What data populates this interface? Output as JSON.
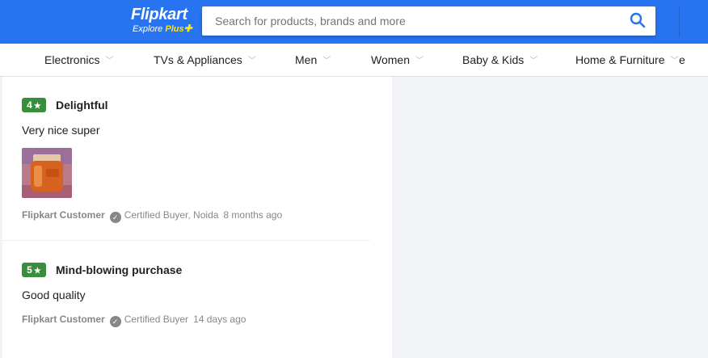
{
  "header": {
    "logo_name": "Flipkart",
    "logo_explore": "Explore",
    "logo_plus": "Plus",
    "search_placeholder": "Search for products, brands and more",
    "brand_color": "#2874f0",
    "accent_color": "#ffe500"
  },
  "nav": {
    "items": [
      {
        "label": "Electronics"
      },
      {
        "label": "TVs & Appliances"
      },
      {
        "label": "Men"
      },
      {
        "label": "Women"
      },
      {
        "label": "Baby & Kids"
      },
      {
        "label": "Home & Furniture"
      },
      {
        "label": "e"
      }
    ]
  },
  "reviews": [
    {
      "rating": "4",
      "title": "Delightful",
      "text": "Very nice super",
      "has_image": true,
      "author": "Flipkart Customer",
      "certified": "Certified Buyer, Noida",
      "ago": "8 months ago",
      "badge_color": "#388e3c"
    },
    {
      "rating": "5",
      "title": "Mind-blowing purchase",
      "text": "Good quality",
      "has_image": false,
      "author": "Flipkart Customer",
      "certified": "Certified Buyer",
      "ago": "14 days ago",
      "badge_color": "#388e3c"
    }
  ],
  "icons": {
    "search": "search-icon",
    "check": "certified-check-icon",
    "chevron": "chevron-down-icon",
    "star": "star-icon"
  }
}
